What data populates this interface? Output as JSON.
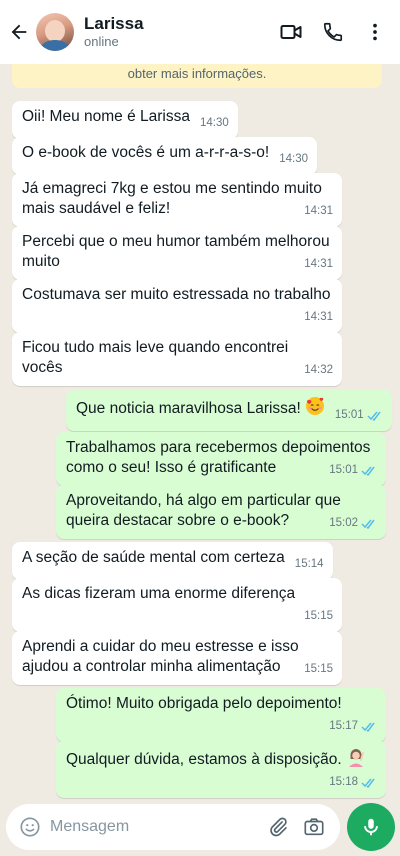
{
  "header": {
    "contact_name": "Larissa",
    "status": "online"
  },
  "notice": {
    "text": "obter mais informações."
  },
  "messages": [
    {
      "dir": "in",
      "text": "Oii! Meu nome é Larissa",
      "time": "14:30"
    },
    {
      "dir": "in",
      "text": "O e-book de vocês é um a-r-r-a-s-o!",
      "time": "14:30"
    },
    {
      "dir": "in",
      "text": "Já emagreci 7kg e estou me sentindo muito mais saudável e feliz!",
      "time": "14:31"
    },
    {
      "dir": "in",
      "text": "Percebi que o meu humor também melhorou muito",
      "time": "14:31"
    },
    {
      "dir": "in",
      "text": "Costumava ser muito estressada no trabalho",
      "time": "14:31"
    },
    {
      "dir": "in",
      "text": "Ficou tudo mais leve quando encontrei vocês",
      "time": "14:32"
    },
    {
      "dir": "out",
      "text": "Que noticia maravilhosa Larissa!",
      "emoji": "smiling-face-with-hearts",
      "time": "15:01",
      "status": "read"
    },
    {
      "dir": "out",
      "text": "Trabalhamos para recebermos depoimentos como o seu! Isso é gratificante",
      "time": "15:01",
      "status": "read"
    },
    {
      "dir": "out",
      "text": "Aproveitando, há algo em particular que queira destacar sobre o e-book?",
      "time": "15:02",
      "status": "read"
    },
    {
      "dir": "in",
      "text": "A seção de saúde mental com certeza",
      "time": "15:14"
    },
    {
      "dir": "in",
      "text": "As dicas fizeram uma enorme diferença",
      "time": "15:15"
    },
    {
      "dir": "in",
      "text": "Aprendi a cuidar do meu estresse e isso ajudou a controlar minha alimentação",
      "time": "15:15"
    },
    {
      "dir": "out",
      "text": "Ótimo! Muito obrigada pelo depoimento!",
      "time": "15:17",
      "status": "read"
    },
    {
      "dir": "out",
      "text": "Qualquer dúvida, estamos à disposição.",
      "emoji": "woman-raising-hand",
      "time": "15:18",
      "status": "read"
    }
  ],
  "input": {
    "placeholder": "Mensagem"
  },
  "icons": {
    "back": "arrow-left-icon",
    "video": "video-call-icon",
    "call": "phone-icon",
    "menu": "more-vertical-icon",
    "emoji": "emoji-icon",
    "attach": "paperclip-icon",
    "camera": "camera-icon",
    "mic": "microphone-icon"
  },
  "colors": {
    "chat_bg": "#efeae2",
    "incoming": "#ffffff",
    "outgoing": "#d9fdd3",
    "accent": "#1daa61",
    "read_ticks": "#53bdeb",
    "notice": "#fdf3c4"
  }
}
